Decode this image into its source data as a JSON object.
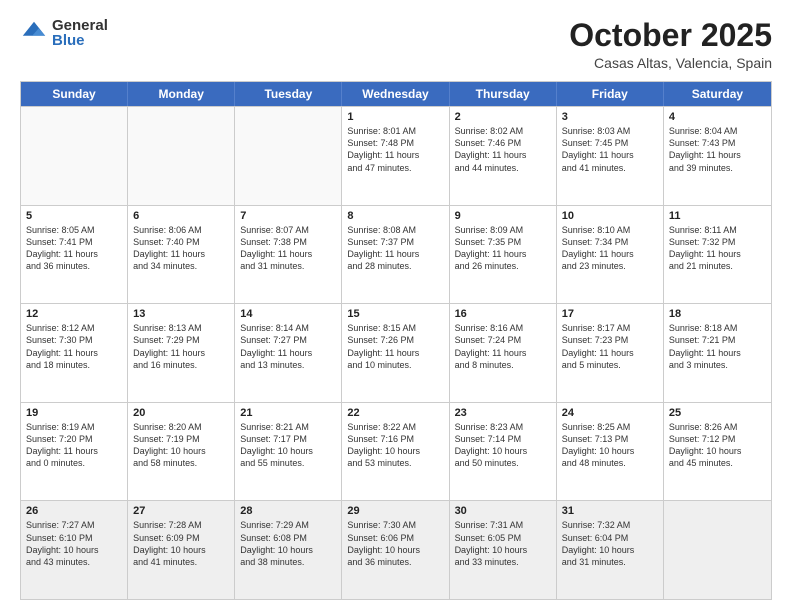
{
  "logo": {
    "general": "General",
    "blue": "Blue"
  },
  "header": {
    "title": "October 2025",
    "subtitle": "Casas Altas, Valencia, Spain"
  },
  "day_headers": [
    "Sunday",
    "Monday",
    "Tuesday",
    "Wednesday",
    "Thursday",
    "Friday",
    "Saturday"
  ],
  "weeks": [
    [
      {
        "date": "",
        "info": ""
      },
      {
        "date": "",
        "info": ""
      },
      {
        "date": "",
        "info": ""
      },
      {
        "date": "1",
        "info": "Sunrise: 8:01 AM\nSunset: 7:48 PM\nDaylight: 11 hours\nand 47 minutes."
      },
      {
        "date": "2",
        "info": "Sunrise: 8:02 AM\nSunset: 7:46 PM\nDaylight: 11 hours\nand 44 minutes."
      },
      {
        "date": "3",
        "info": "Sunrise: 8:03 AM\nSunset: 7:45 PM\nDaylight: 11 hours\nand 41 minutes."
      },
      {
        "date": "4",
        "info": "Sunrise: 8:04 AM\nSunset: 7:43 PM\nDaylight: 11 hours\nand 39 minutes."
      }
    ],
    [
      {
        "date": "5",
        "info": "Sunrise: 8:05 AM\nSunset: 7:41 PM\nDaylight: 11 hours\nand 36 minutes."
      },
      {
        "date": "6",
        "info": "Sunrise: 8:06 AM\nSunset: 7:40 PM\nDaylight: 11 hours\nand 34 minutes."
      },
      {
        "date": "7",
        "info": "Sunrise: 8:07 AM\nSunset: 7:38 PM\nDaylight: 11 hours\nand 31 minutes."
      },
      {
        "date": "8",
        "info": "Sunrise: 8:08 AM\nSunset: 7:37 PM\nDaylight: 11 hours\nand 28 minutes."
      },
      {
        "date": "9",
        "info": "Sunrise: 8:09 AM\nSunset: 7:35 PM\nDaylight: 11 hours\nand 26 minutes."
      },
      {
        "date": "10",
        "info": "Sunrise: 8:10 AM\nSunset: 7:34 PM\nDaylight: 11 hours\nand 23 minutes."
      },
      {
        "date": "11",
        "info": "Sunrise: 8:11 AM\nSunset: 7:32 PM\nDaylight: 11 hours\nand 21 minutes."
      }
    ],
    [
      {
        "date": "12",
        "info": "Sunrise: 8:12 AM\nSunset: 7:30 PM\nDaylight: 11 hours\nand 18 minutes."
      },
      {
        "date": "13",
        "info": "Sunrise: 8:13 AM\nSunset: 7:29 PM\nDaylight: 11 hours\nand 16 minutes."
      },
      {
        "date": "14",
        "info": "Sunrise: 8:14 AM\nSunset: 7:27 PM\nDaylight: 11 hours\nand 13 minutes."
      },
      {
        "date": "15",
        "info": "Sunrise: 8:15 AM\nSunset: 7:26 PM\nDaylight: 11 hours\nand 10 minutes."
      },
      {
        "date": "16",
        "info": "Sunrise: 8:16 AM\nSunset: 7:24 PM\nDaylight: 11 hours\nand 8 minutes."
      },
      {
        "date": "17",
        "info": "Sunrise: 8:17 AM\nSunset: 7:23 PM\nDaylight: 11 hours\nand 5 minutes."
      },
      {
        "date": "18",
        "info": "Sunrise: 8:18 AM\nSunset: 7:21 PM\nDaylight: 11 hours\nand 3 minutes."
      }
    ],
    [
      {
        "date": "19",
        "info": "Sunrise: 8:19 AM\nSunset: 7:20 PM\nDaylight: 11 hours\nand 0 minutes."
      },
      {
        "date": "20",
        "info": "Sunrise: 8:20 AM\nSunset: 7:19 PM\nDaylight: 10 hours\nand 58 minutes."
      },
      {
        "date": "21",
        "info": "Sunrise: 8:21 AM\nSunset: 7:17 PM\nDaylight: 10 hours\nand 55 minutes."
      },
      {
        "date": "22",
        "info": "Sunrise: 8:22 AM\nSunset: 7:16 PM\nDaylight: 10 hours\nand 53 minutes."
      },
      {
        "date": "23",
        "info": "Sunrise: 8:23 AM\nSunset: 7:14 PM\nDaylight: 10 hours\nand 50 minutes."
      },
      {
        "date": "24",
        "info": "Sunrise: 8:25 AM\nSunset: 7:13 PM\nDaylight: 10 hours\nand 48 minutes."
      },
      {
        "date": "25",
        "info": "Sunrise: 8:26 AM\nSunset: 7:12 PM\nDaylight: 10 hours\nand 45 minutes."
      }
    ],
    [
      {
        "date": "26",
        "info": "Sunrise: 7:27 AM\nSunset: 6:10 PM\nDaylight: 10 hours\nand 43 minutes."
      },
      {
        "date": "27",
        "info": "Sunrise: 7:28 AM\nSunset: 6:09 PM\nDaylight: 10 hours\nand 41 minutes."
      },
      {
        "date": "28",
        "info": "Sunrise: 7:29 AM\nSunset: 6:08 PM\nDaylight: 10 hours\nand 38 minutes."
      },
      {
        "date": "29",
        "info": "Sunrise: 7:30 AM\nSunset: 6:06 PM\nDaylight: 10 hours\nand 36 minutes."
      },
      {
        "date": "30",
        "info": "Sunrise: 7:31 AM\nSunset: 6:05 PM\nDaylight: 10 hours\nand 33 minutes."
      },
      {
        "date": "31",
        "info": "Sunrise: 7:32 AM\nSunset: 6:04 PM\nDaylight: 10 hours\nand 31 minutes."
      },
      {
        "date": "",
        "info": ""
      }
    ]
  ]
}
